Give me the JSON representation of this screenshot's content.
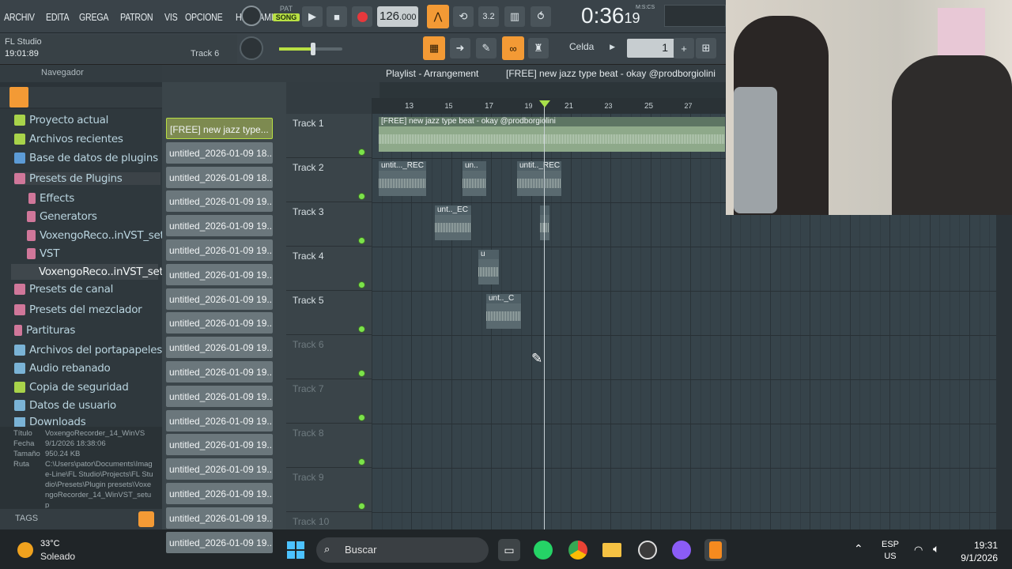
{
  "menu": [
    "ARCHIV",
    "EDITA",
    "GREGA",
    "PATRON",
    "VIS",
    "OPCIONE",
    "HERRAMIENTA"
  ],
  "transport": {
    "mode_pat": "PAT",
    "mode_song": "SONG",
    "tempo": "126",
    "tempo_dec": ".000",
    "time": "0:36",
    "time_sub": "19",
    "time_label": "M:S:CS"
  },
  "hint": {
    "app": "FL Studio",
    "clock": "19:01:89",
    "track": "Track 6"
  },
  "snap": {
    "label": "Celda",
    "value": "1"
  },
  "browser": {
    "header": "Navegador",
    "items": [
      "Proyecto actual",
      "Archivos recientes",
      "Base de datos de plugins",
      "Presets de Plugins",
      "Effects",
      "Generators",
      "VoxengoReco..inVST_setup",
      "VST",
      "VoxengoReco..inVST_setup",
      "Presets de canal",
      "Presets del mezclador",
      "Partituras",
      "Archivos del portapapeles",
      "Audio rebanado",
      "Copia de seguridad",
      "Datos de usuario",
      "Downloads"
    ],
    "info": {
      "titulo_label": "Título",
      "titulo": "VoxengoRecorder_14_WinVS",
      "fecha_label": "Fecha",
      "fecha": "9/1/2026 18:38:06",
      "tamano_label": "Tamaño",
      "tamano": "950.24 KB",
      "ruta_label": "Ruta",
      "ruta": "C:\\Users\\pator\\Documents\\Image-Line\\FL Studio\\Projects\\FL Studio\\Presets\\Plugin presets\\VoxengoRecorder_14_WinVST_setup"
    },
    "tags": "TAGS"
  },
  "channels": [
    "[FREE] new jazz type...",
    "untitled_2026-01-09 18...",
    "untitled_2026-01-09 18...",
    "untitled_2026-01-09 19...",
    "untitled_2026-01-09 19...",
    "untitled_2026-01-09 19...",
    "untitled_2026-01-09 19...",
    "untitled_2026-01-09 19...",
    "untitled_2026-01-09 19...",
    "untitled_2026-01-09 19...",
    "untitled_2026-01-09 19...",
    "untitled_2026-01-09 19...",
    "untitled_2026-01-09 19...",
    "untitled_2026-01-09 19...",
    "untitled_2026-01-09 19...",
    "untitled_2026-01-09 19...",
    "untitled_2026-01-09 19...",
    "untitled_2026-01-09 19..."
  ],
  "playlist": {
    "title": "Playlist - Arrangement",
    "pattern": "[FREE] new jazz type beat - okay @prodborgiolini",
    "tracks": [
      "Track 1",
      "Track 2",
      "Track 3",
      "Track 4",
      "Track 5",
      "Track 6",
      "Track 7",
      "Track 8",
      "Track 9",
      "Track 10"
    ],
    "ruler": [
      "13",
      "15",
      "17",
      "19",
      "21",
      "23",
      "25",
      "27"
    ],
    "clips": {
      "c1": "[FREE] new jazz type beat - okay @prodborgiolini",
      "c2a": "untit..._REC",
      "c2b": "un..",
      "c2c": "untit.._REC",
      "c3a": "unt.._EC",
      "c4": "u",
      "c5": "unt.._C"
    }
  },
  "taskbar": {
    "temp": "33°C",
    "weather": "Soleado",
    "search": "Buscar",
    "lang1": "ESP",
    "lang2": "US",
    "time": "19:31",
    "date": "9/1/2026"
  }
}
